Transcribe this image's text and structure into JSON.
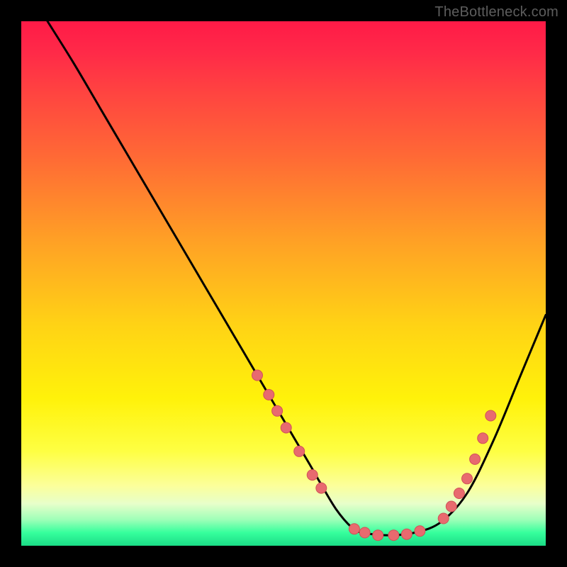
{
  "watermark": "TheBottleneck.com",
  "colors": {
    "background": "#000000",
    "watermark_text": "#5d5d5d",
    "curve_stroke": "#000000",
    "dot_fill": "#e86a6f",
    "dot_stroke": "#d05257"
  },
  "chart_data": {
    "type": "line",
    "title": "",
    "xlabel": "",
    "ylabel": "",
    "xlim": [
      0,
      100
    ],
    "ylim": [
      0,
      100
    ],
    "grid": false,
    "legend": null,
    "note": "Axes are unlabeled percentage-style; values below are estimated from pixel positions where 0,0 is bottom-left of the colored plot area and 100,100 is top-right.",
    "series": [
      {
        "name": "bottleneck-curve",
        "x": [
          5,
          10,
          15,
          20,
          25,
          30,
          35,
          40,
          45,
          50,
          55,
          57,
          60,
          63,
          65,
          70,
          75,
          80,
          85,
          90,
          95,
          100
        ],
        "values": [
          100,
          92,
          83.5,
          75,
          66.5,
          58,
          49.5,
          41,
          32.5,
          24,
          15.5,
          12,
          7,
          3.5,
          2.5,
          2,
          2.5,
          4.5,
          10,
          20,
          32,
          44
        ]
      }
    ],
    "highlight_dots": {
      "name": "marked-points",
      "points": [
        {
          "x": 45.0,
          "y": 32.5
        },
        {
          "x": 47.2,
          "y": 28.8
        },
        {
          "x": 48.8,
          "y": 25.7
        },
        {
          "x": 50.5,
          "y": 22.5
        },
        {
          "x": 53.0,
          "y": 18.0
        },
        {
          "x": 55.5,
          "y": 13.5
        },
        {
          "x": 57.2,
          "y": 11.0
        },
        {
          "x": 63.5,
          "y": 3.2
        },
        {
          "x": 65.5,
          "y": 2.5
        },
        {
          "x": 68.0,
          "y": 2.0
        },
        {
          "x": 71.0,
          "y": 2.0
        },
        {
          "x": 73.5,
          "y": 2.2
        },
        {
          "x": 76.0,
          "y": 2.8
        },
        {
          "x": 80.5,
          "y": 5.2
        },
        {
          "x": 82.0,
          "y": 7.5
        },
        {
          "x": 83.5,
          "y": 10.0
        },
        {
          "x": 85.0,
          "y": 12.8
        },
        {
          "x": 86.5,
          "y": 16.5
        },
        {
          "x": 88.0,
          "y": 20.5
        },
        {
          "x": 89.5,
          "y": 24.8
        }
      ]
    }
  }
}
